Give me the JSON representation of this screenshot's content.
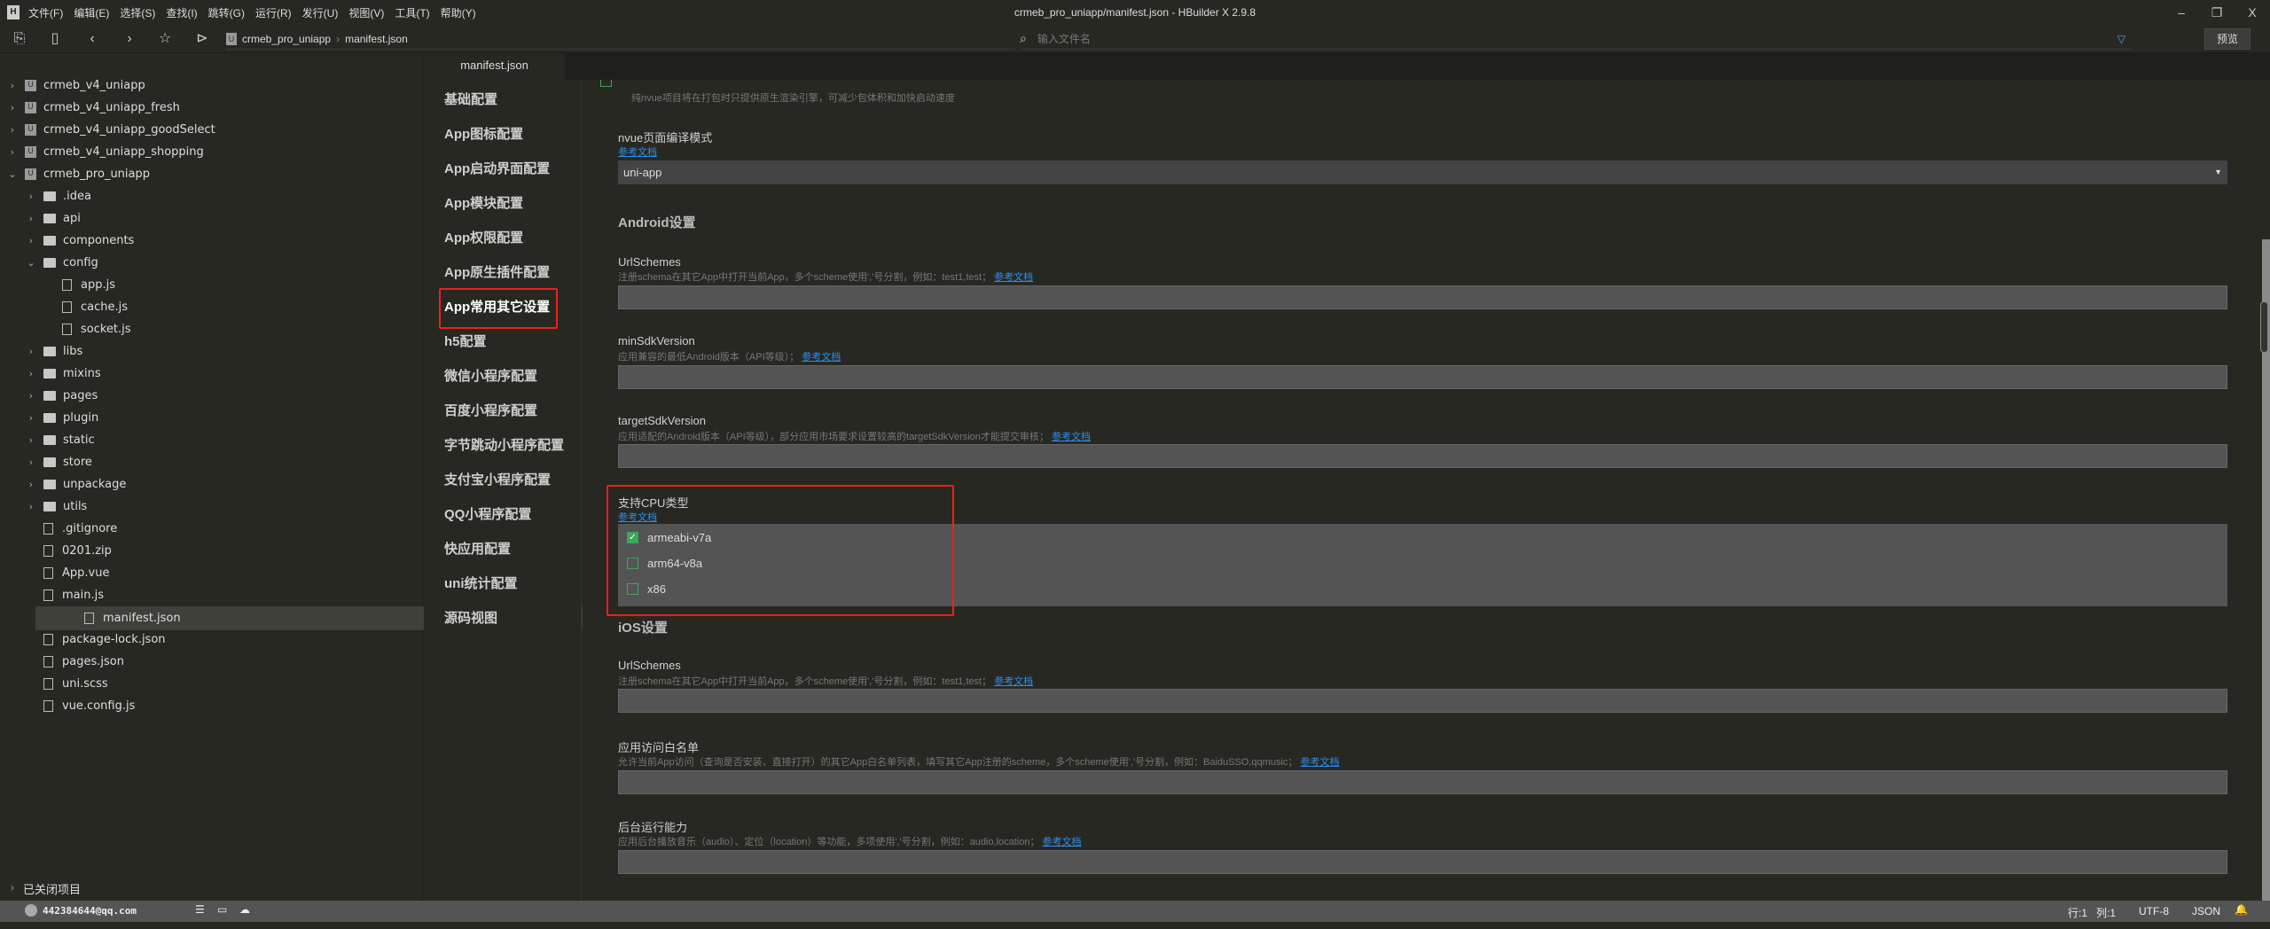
{
  "titlebar": {
    "menus": [
      "文件(F)",
      "编辑(E)",
      "选择(S)",
      "查找(I)",
      "跳转(G)",
      "运行(R)",
      "发行(U)",
      "视图(V)",
      "工具(T)",
      "帮助(Y)"
    ],
    "title": "crmeb_pro_uniapp/manifest.json - HBuilder X 2.9.8",
    "minimize": "–",
    "maximize": "❐",
    "close": "X"
  },
  "toolbar": {
    "breadcrumb": [
      "crmeb_pro_uniapp",
      "manifest.json"
    ],
    "file_search_placeholder": "输入文件名",
    "preview_label": "预览"
  },
  "tab": {
    "label": "manifest.json"
  },
  "tree": [
    {
      "label": "crmeb_v4_uniapp",
      "type": "project",
      "level": 0,
      "open": false
    },
    {
      "label": "crmeb_v4_uniapp_fresh",
      "type": "project",
      "level": 0,
      "open": false
    },
    {
      "label": "crmeb_v4_uniapp_goodSelect",
      "type": "project",
      "level": 0,
      "open": false
    },
    {
      "label": "crmeb_v4_uniapp_shopping",
      "type": "project",
      "level": 0,
      "open": false
    },
    {
      "label": "crmeb_pro_uniapp",
      "type": "project",
      "level": 0,
      "open": true
    },
    {
      "label": ".idea",
      "type": "folder",
      "level": 1,
      "open": false
    },
    {
      "label": "api",
      "type": "folder",
      "level": 1,
      "open": false
    },
    {
      "label": "components",
      "type": "folder",
      "level": 1,
      "open": false
    },
    {
      "label": "config",
      "type": "folder",
      "level": 1,
      "open": true
    },
    {
      "label": "app.js",
      "type": "file",
      "level": 2
    },
    {
      "label": "cache.js",
      "type": "file",
      "level": 2
    },
    {
      "label": "socket.js",
      "type": "file",
      "level": 2
    },
    {
      "label": "libs",
      "type": "folder",
      "level": 1,
      "open": false
    },
    {
      "label": "mixins",
      "type": "folder",
      "level": 1,
      "open": false
    },
    {
      "label": "pages",
      "type": "folder",
      "level": 1,
      "open": false
    },
    {
      "label": "plugin",
      "type": "folder",
      "level": 1,
      "open": false
    },
    {
      "label": "static",
      "type": "folder",
      "level": 1,
      "open": false
    },
    {
      "label": "store",
      "type": "folder",
      "level": 1,
      "open": false
    },
    {
      "label": "unpackage",
      "type": "folder",
      "level": 1,
      "open": false
    },
    {
      "label": "utils",
      "type": "folder",
      "level": 1,
      "open": false
    },
    {
      "label": ".gitignore",
      "type": "file",
      "level": 1
    },
    {
      "label": "0201.zip",
      "type": "file",
      "level": 1
    },
    {
      "label": "App.vue",
      "type": "file",
      "level": 1
    },
    {
      "label": "main.js",
      "type": "file",
      "level": 1
    },
    {
      "label": "manifest.json",
      "type": "file",
      "level": 1,
      "selected": true
    },
    {
      "label": "package-lock.json",
      "type": "file",
      "level": 1
    },
    {
      "label": "pages.json",
      "type": "file",
      "level": 1
    },
    {
      "label": "uni.scss",
      "type": "file",
      "level": 1
    },
    {
      "label": "vue.config.js",
      "type": "file",
      "level": 1
    }
  ],
  "closed_projects": "已关闭项目",
  "status": {
    "user": "442384644@qq.com",
    "line": "行:1",
    "col": "列:1",
    "encoding": "UTF-8",
    "lang": "JSON"
  },
  "nav": [
    "基础配置",
    "App图标配置",
    "App启动界面配置",
    "App模块配置",
    "App权限配置",
    "App原生插件配置",
    "App常用其它设置",
    "h5配置",
    "微信小程序配置",
    "百度小程序配置",
    "字节跳动小程序配置",
    "支付宝小程序配置",
    "QQ小程序配置",
    "快应用配置",
    "uni统计配置",
    "源码视图"
  ],
  "nav_active": 6,
  "highlight_color": "#f01e1e",
  "content": {
    "nvue_only_desc": "纯nvue项目将在打包时只提供原生渲染引擎，可减少包体积和加快启动速度",
    "nvue_mode": {
      "label": "nvue页面编译模式",
      "link": "参考文档",
      "value": "uni-app"
    },
    "android_title": "Android设置",
    "android_url": {
      "label": "UrlSchemes",
      "desc": "注册schema在其它App中打开当前App，多个scheme使用','号分割，例如：test1,test；",
      "link": "参考文档",
      "value": ""
    },
    "min_sdk": {
      "label": "minSdkVersion",
      "desc": "应用兼容的最低Android版本（API等级）；",
      "link": "参考文档",
      "value": ""
    },
    "target_sdk": {
      "label": "targetSdkVersion",
      "desc": "应用适配的Android版本（API等级），部分应用市场要求设置较高的targetSdkVersion才能提交审核；",
      "link": "参考文档",
      "value": ""
    },
    "cpu": {
      "label": "支持CPU类型",
      "link": "参考文档",
      "options": [
        {
          "label": "armeabi-v7a",
          "checked": true
        },
        {
          "label": "arm64-v8a",
          "checked": false
        },
        {
          "label": "x86",
          "checked": false
        }
      ]
    },
    "ios_title": "iOS设置",
    "ios_url": {
      "label": "UrlSchemes",
      "desc": "注册schema在其它App中打开当前App，多个scheme使用','号分割，例如：test1,test；",
      "link": "参考文档",
      "value": ""
    },
    "whitelist": {
      "label": "应用访问白名单",
      "desc": "允许当前App访问（查询是否安装、直接打开）的其它App白名单列表，填写其它App注册的scheme，多个scheme使用','号分割，例如：BaiduSSO,qqmusic；",
      "link": "参考文档",
      "value": ""
    },
    "background": {
      "label": "后台运行能力",
      "desc": "应用后台播放音乐（audio）、定位（location）等功能，多项使用','号分割，例如：audio,location；",
      "link": "参考文档",
      "value": ""
    }
  }
}
